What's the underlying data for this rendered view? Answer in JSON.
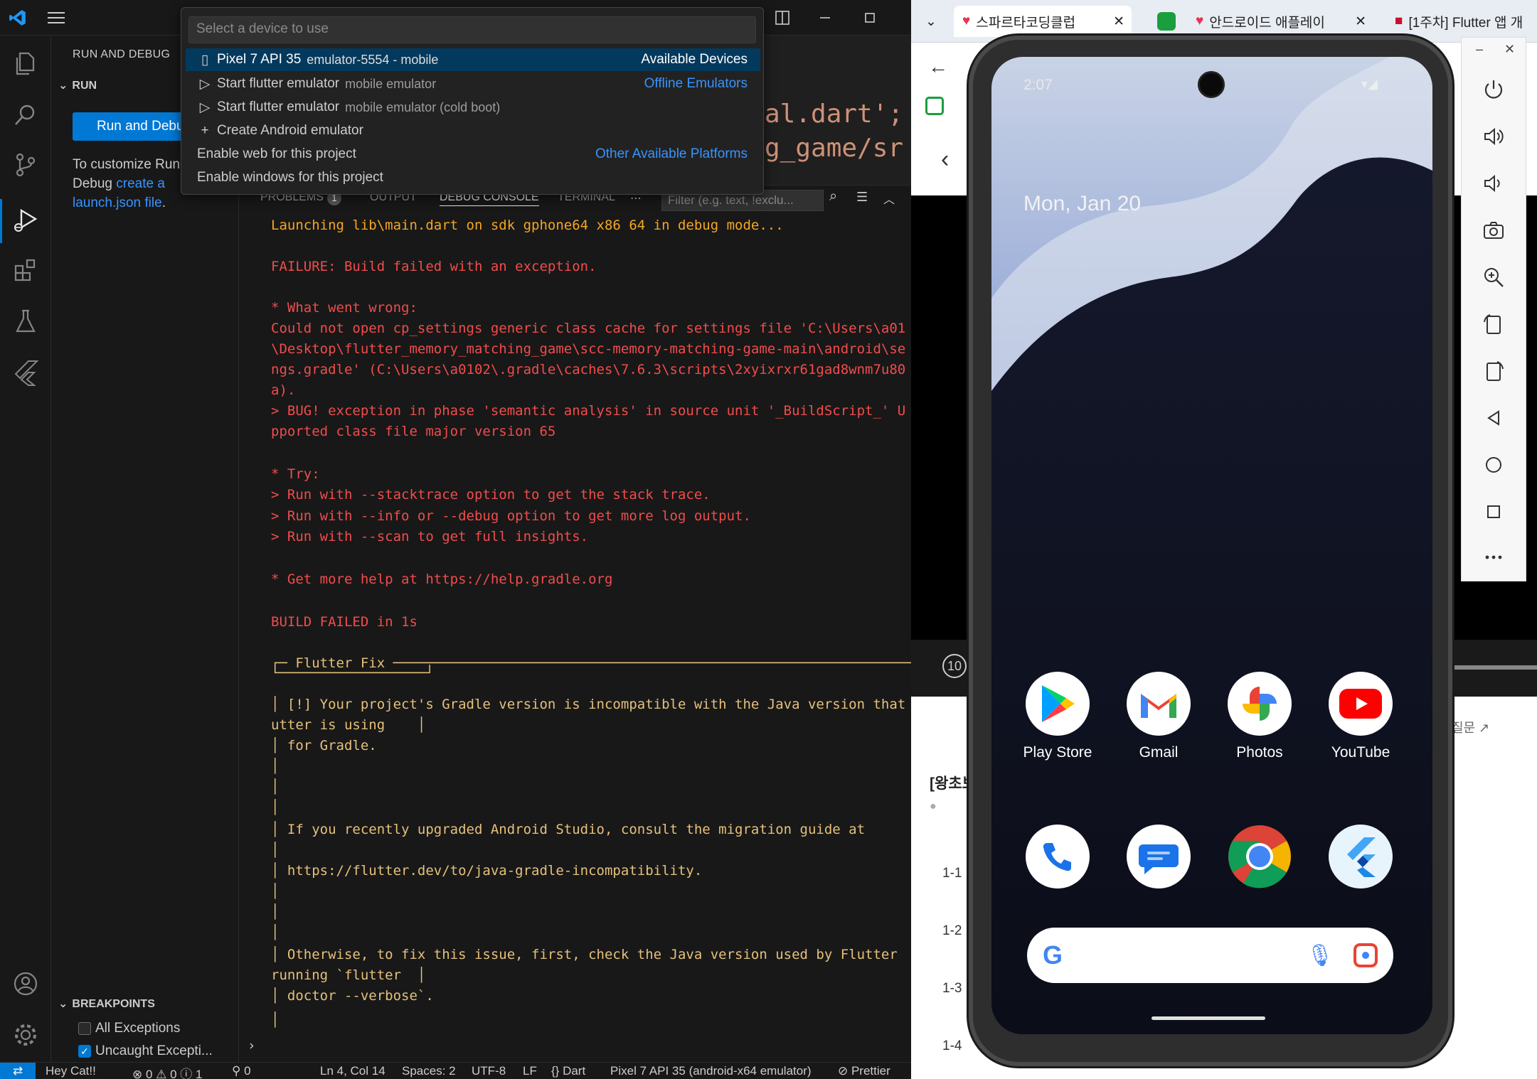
{
  "quickpick": {
    "placeholder": "Select a device to use",
    "rows": [
      {
        "label": "Pixel 7 API 35",
        "desc": "emulator-5554 - mobile",
        "group": "Available Devices"
      },
      {
        "label": "Start flutter emulator",
        "desc": "mobile emulator",
        "group": "Offline Emulators"
      },
      {
        "label": "Start flutter emulator",
        "desc": "mobile emulator (cold boot)",
        "group": ""
      },
      {
        "label": "Create Android emulator",
        "desc": "",
        "group": ""
      },
      {
        "label": "Enable web for this project",
        "desc": "",
        "group": "Other Available Platforms"
      },
      {
        "label": "Enable windows for this project",
        "desc": "",
        "group": ""
      }
    ]
  },
  "sidebar": {
    "title": "RUN AND DEBUG",
    "run_section": "RUN",
    "run_button": "Run and Debug",
    "customize_prefix": "To customize Run and Debug",
    "customize_link1": "create a launch.json file",
    "customize_suffix": ".",
    "breakpoints_title": "BREAKPOINTS",
    "breakpoints": [
      {
        "label": "All Exceptions",
        "checked": false
      },
      {
        "label": "Uncaught Excepti...",
        "checked": true
      }
    ]
  },
  "editor": {
    "line1": "al.dart';",
    "line2": "g_game/sr"
  },
  "panel": {
    "tabs": [
      "PROBLEMS",
      "OUTPUT",
      "DEBUG CONSOLE",
      "TERMINAL"
    ],
    "problems_count": "1",
    "filter_placeholder": "Filter (e.g. text, !exclu...",
    "lines": [
      {
        "t": "Launching lib\\main.dart on sdk gphone64 x86 64 in debug mode...",
        "c": "o"
      },
      {
        "t": "FAILURE: Build failed with an exception.",
        "c": "r"
      },
      {
        "t": "* What went wrong:",
        "c": "r"
      },
      {
        "t": "Could not open cp_settings generic class cache for settings file 'C:\\Users\\a01",
        "c": "r"
      },
      {
        "t": "\\Desktop\\flutter_memory_matching_game\\scc-memory-matching-game-main\\android\\se",
        "c": "r"
      },
      {
        "t": "ngs.gradle' (C:\\Users\\a0102\\.gradle\\caches\\7.6.3\\scripts\\2xyixrxr61gad8wnm7u80",
        "c": "r"
      },
      {
        "t": "a).",
        "c": "r"
      },
      {
        "t": "> BUG! exception in phase 'semantic analysis' in source unit '_BuildScript_' U",
        "c": "r"
      },
      {
        "t": "pported class file major version 65",
        "c": "r"
      },
      {
        "t": "* Try:",
        "c": "r"
      },
      {
        "t": "> Run with --stacktrace option to get the stack trace.",
        "c": "r"
      },
      {
        "t": "> Run with --info or --debug option to get more log output.",
        "c": "r"
      },
      {
        "t": "> Run with --scan to get full insights.",
        "c": "r"
      },
      {
        "t": "* Get more help at https://help.gradle.org",
        "c": "r"
      },
      {
        "t": "BUILD FAILED in 1s",
        "c": "r"
      },
      {
        "t": "┌─ Flutter Fix ─────────────────────────────────────────────────────────────────",
        "c": "y"
      },
      {
        "t": "│ [!] Your project's Gradle version is incompatible with the Java version that",
        "c": "y"
      },
      {
        "t": "utter is using    │",
        "c": "y"
      },
      {
        "t": "│ for Gradle.",
        "c": "y"
      },
      {
        "t": "│",
        "c": "y"
      },
      {
        "t": "│",
        "c": "y"
      },
      {
        "t": "│",
        "c": "y"
      },
      {
        "t": "│ If you recently upgraded Android Studio, consult the migration guide at",
        "c": "y"
      },
      {
        "t": "│",
        "c": "y"
      },
      {
        "t": "│ https://flutter.dev/to/java-gradle-incompatibility.",
        "c": "y"
      },
      {
        "t": "│",
        "c": "y"
      },
      {
        "t": "│",
        "c": "y"
      },
      {
        "t": "│",
        "c": "y"
      },
      {
        "t": "│ Otherwise, to fix this issue, first, check the Java version used by Flutter",
        "c": "y"
      },
      {
        "t": "running `flutter  │",
        "c": "y"
      },
      {
        "t": "│ doctor --verbose`.",
        "c": "y"
      },
      {
        "t": "│",
        "c": "y"
      }
    ]
  },
  "statusbar": {
    "items": [
      "Hey Cat!!",
      "⊗ 0 ⚠ 0 ⓘ 1",
      "⚲ 0",
      "Ln 4, Col 14",
      "Spaces: 2",
      "UTF-8",
      "LF",
      "{} Dart",
      "Pixel 7 API 35 (android-x64 emulator)",
      "⊘ Prettier"
    ]
  },
  "browser": {
    "tabs": [
      "스파르타코딩클럽",
      "안드로이드 애플레이",
      "[1주차] Flutter 앱 개"
    ],
    "course_title": "[왕초보",
    "course_link": "질문",
    "lessons": [
      "1-1",
      "1-2",
      "1-3",
      "1-4"
    ]
  },
  "emulator": {
    "time": "2:07",
    "date": "Mon, Jan 20",
    "apps": [
      {
        "label": "Play Store",
        "icon": "play-store-icon"
      },
      {
        "label": "Gmail",
        "icon": "gmail-icon"
      },
      {
        "label": "Photos",
        "icon": "photos-icon"
      },
      {
        "label": "YouTube",
        "icon": "youtube-icon"
      },
      {
        "label": "",
        "icon": "phone-icon"
      },
      {
        "label": "",
        "icon": "messages-icon"
      },
      {
        "label": "",
        "icon": "chrome-icon"
      },
      {
        "label": "",
        "icon": "flutter-icon"
      }
    ]
  },
  "colors": {
    "accent": "#0078d4",
    "error": "#f14c4c",
    "warning": "#e5c07b"
  }
}
